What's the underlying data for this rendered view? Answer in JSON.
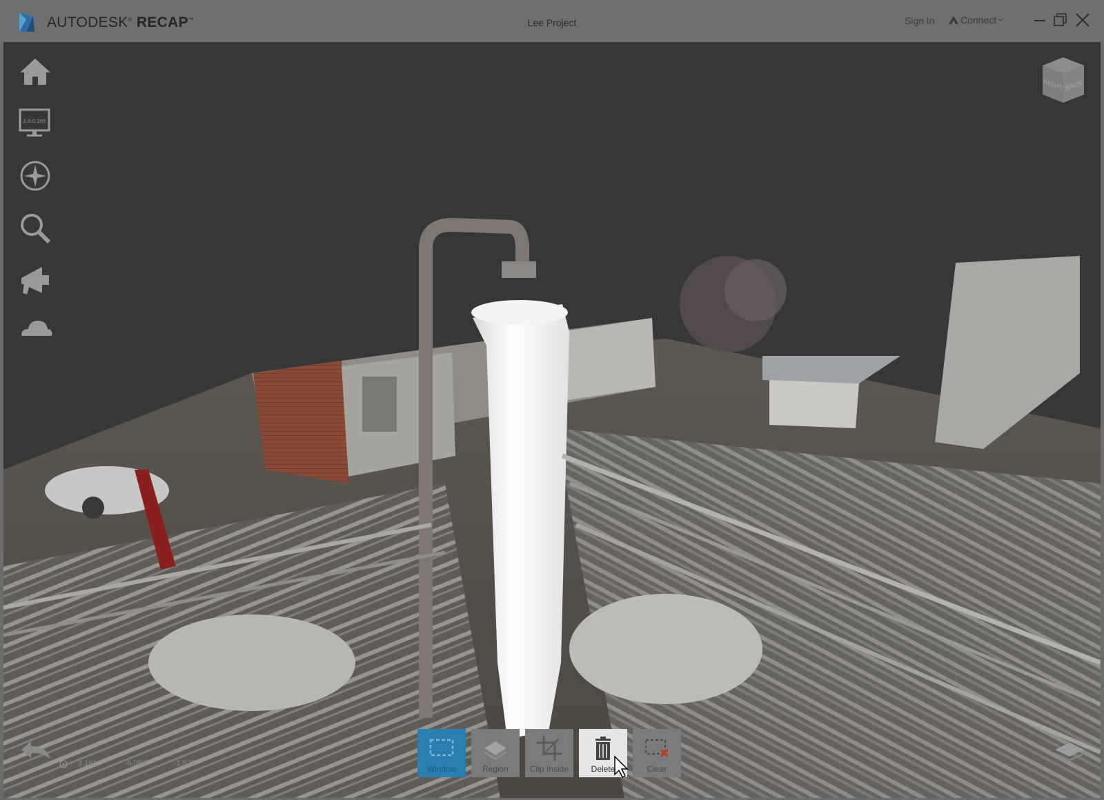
{
  "app": {
    "brand_primary": "AUTODESK",
    "brand_secondary": "RECAP",
    "trademark": "®",
    "tm": "™",
    "project_title": "Lee Project",
    "sign_in": "Sign In",
    "connect": "Connect"
  },
  "window_controls": [
    "minimize-icon",
    "restore-icon",
    "close-icon"
  ],
  "left_tools": [
    {
      "icon": "home-icon"
    },
    {
      "icon": "monitor-icon",
      "caption": "2.0.0.205"
    },
    {
      "icon": "compass-icon"
    },
    {
      "icon": "search-icon"
    },
    {
      "icon": "megaphone-icon"
    },
    {
      "icon": "cloud-icon"
    }
  ],
  "viewcube": {
    "face_right": "BACK",
    "face_left": "RIGHT"
  },
  "selection_tools": [
    {
      "label": "Window",
      "icon": "window-select-icon",
      "state": "active"
    },
    {
      "label": "Region",
      "icon": "region-icon",
      "state": "normal"
    },
    {
      "label": "Clip Inside",
      "icon": "crop-icon",
      "state": "normal"
    },
    {
      "label": "Delete",
      "icon": "trash-icon",
      "state": "hover"
    },
    {
      "label": "Clear",
      "icon": "clear-selection-icon",
      "state": "normal"
    }
  ],
  "coordinates": {
    "x": "3.161",
    "y": "-6.058",
    "z": "-1.527"
  },
  "colors": {
    "titlebar": "#6f6f6f",
    "viewport_bg": "#373737",
    "active_tool": "#2a7fb0",
    "hover_tool": "#e6e6e6"
  }
}
